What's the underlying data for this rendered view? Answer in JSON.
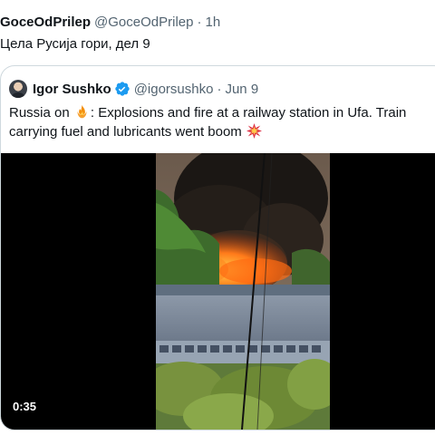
{
  "post": {
    "author_name": "GoceOdPrilep",
    "author_handle": "@GoceOdPrilep",
    "separator": "·",
    "timestamp": "1h",
    "text": "Цела Русија гори, дел 9"
  },
  "quoted_post": {
    "author_name": "Igor Sushko",
    "verified": true,
    "author_handle": "@igorsushko",
    "separator": "·",
    "timestamp": "Jun 9",
    "text_part1": "Russia on",
    "text_part2": ": Explosions and fire at a railway station in Ufa. Train",
    "text_line2": "carrying fuel and lubricants went boom",
    "emojis": [
      "fire-emoji",
      "collision-emoji"
    ],
    "media": {
      "type": "video",
      "duration": "0:35"
    }
  },
  "colors": {
    "text_primary": "#0f1419",
    "text_secondary": "#536471",
    "border": "#cfd9de",
    "verified_blue": "#1d9bf0"
  }
}
